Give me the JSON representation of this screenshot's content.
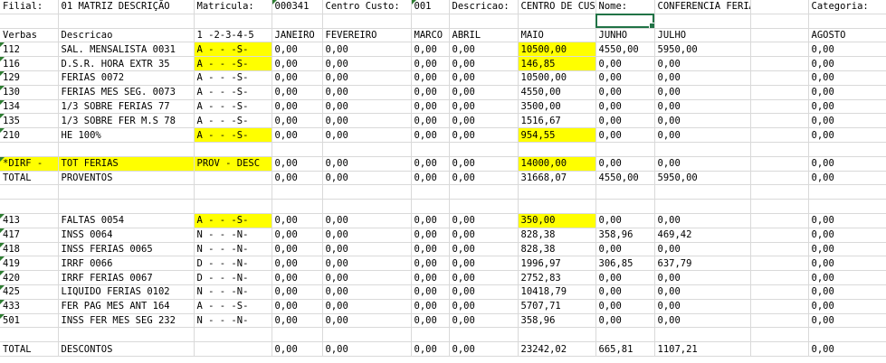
{
  "columns": 12,
  "highlight_color": "#ffff00",
  "rows": [
    {
      "cells": [
        {
          "t": "Filial:"
        },
        {
          "t": "01 MATRIZ DESCRIÇÃO"
        },
        {
          "t": "Matricula:"
        },
        {
          "t": "000341",
          "flag": true
        },
        {
          "t": "Centro Custo:"
        },
        {
          "t": "001",
          "flag": true
        },
        {
          "t": "Descricao:"
        },
        {
          "t": "CENTRO DE CUSTO"
        },
        {
          "t": "Nome:"
        },
        {
          "t": "CONFERENCIA FERIAS DIRF"
        },
        {
          "t": ""
        },
        {
          "t": "Categoria:"
        }
      ]
    },
    {
      "cells": [
        {
          "t": ""
        },
        {
          "t": ""
        },
        {
          "t": ""
        },
        {
          "t": ""
        },
        {
          "t": ""
        },
        {
          "t": ""
        },
        {
          "t": ""
        },
        {
          "t": ""
        },
        {
          "t": "",
          "sel": true
        },
        {
          "t": ""
        },
        {
          "t": ""
        },
        {
          "t": ""
        }
      ]
    },
    {
      "cells": [
        {
          "t": "Verbas"
        },
        {
          "t": "Descricao"
        },
        {
          "t": "1 -2-3-4-5"
        },
        {
          "t": "JANEIRO"
        },
        {
          "t": "FEVEREIRO"
        },
        {
          "t": "MARCO"
        },
        {
          "t": "ABRIL"
        },
        {
          "t": "MAIO"
        },
        {
          "t": "JUNHO"
        },
        {
          "t": "JULHO"
        },
        {
          "t": ""
        },
        {
          "t": "AGOSTO"
        }
      ]
    },
    {
      "cells": [
        {
          "t": "112",
          "flag": true
        },
        {
          "t": "SAL. MENSALISTA 0031"
        },
        {
          "t": "A - - -S-",
          "hl": true
        },
        {
          "t": "0,00"
        },
        {
          "t": "0,00"
        },
        {
          "t": "0,00"
        },
        {
          "t": "0,00"
        },
        {
          "t": "10500,00",
          "hl": true
        },
        {
          "t": "4550,00"
        },
        {
          "t": "5950,00"
        },
        {
          "t": ""
        },
        {
          "t": "0,00"
        }
      ]
    },
    {
      "cells": [
        {
          "t": "116",
          "flag": true
        },
        {
          "t": "D.S.R. HORA EXTR  35"
        },
        {
          "t": "A - - -S-",
          "hl": true
        },
        {
          "t": "0,00"
        },
        {
          "t": "0,00"
        },
        {
          "t": "0,00"
        },
        {
          "t": "0,00"
        },
        {
          "t": "146,85",
          "hl": true
        },
        {
          "t": "0,00"
        },
        {
          "t": "0,00"
        },
        {
          "t": ""
        },
        {
          "t": "0,00"
        }
      ]
    },
    {
      "cells": [
        {
          "t": "129",
          "flag": true
        },
        {
          "t": "FERIAS 0072"
        },
        {
          "t": "A - - -S-"
        },
        {
          "t": "0,00"
        },
        {
          "t": "0,00"
        },
        {
          "t": "0,00"
        },
        {
          "t": "0,00"
        },
        {
          "t": "10500,00"
        },
        {
          "t": "0,00"
        },
        {
          "t": "0,00"
        },
        {
          "t": ""
        },
        {
          "t": "0,00"
        }
      ]
    },
    {
      "cells": [
        {
          "t": "130",
          "flag": true
        },
        {
          "t": "FERIAS MES SEG. 0073"
        },
        {
          "t": "A - - -S-"
        },
        {
          "t": "0,00"
        },
        {
          "t": "0,00"
        },
        {
          "t": "0,00"
        },
        {
          "t": "0,00"
        },
        {
          "t": "4550,00"
        },
        {
          "t": "0,00"
        },
        {
          "t": "0,00"
        },
        {
          "t": ""
        },
        {
          "t": "0,00"
        }
      ]
    },
    {
      "cells": [
        {
          "t": "134",
          "flag": true
        },
        {
          "t": "1/3 SOBRE FERIAS 77"
        },
        {
          "t": "A - - -S-"
        },
        {
          "t": "0,00"
        },
        {
          "t": "0,00"
        },
        {
          "t": "0,00"
        },
        {
          "t": "0,00"
        },
        {
          "t": "3500,00"
        },
        {
          "t": "0,00"
        },
        {
          "t": "0,00"
        },
        {
          "t": ""
        },
        {
          "t": "0,00"
        }
      ]
    },
    {
      "cells": [
        {
          "t": "135",
          "flag": true
        },
        {
          "t": "1/3 SOBRE FER M.S 78"
        },
        {
          "t": "A - - -S-"
        },
        {
          "t": "0,00"
        },
        {
          "t": "0,00"
        },
        {
          "t": "0,00"
        },
        {
          "t": "0,00"
        },
        {
          "t": "1516,67"
        },
        {
          "t": "0,00"
        },
        {
          "t": "0,00"
        },
        {
          "t": ""
        },
        {
          "t": "0,00"
        }
      ]
    },
    {
      "cells": [
        {
          "t": "210",
          "flag": true
        },
        {
          "t": "HE 100%"
        },
        {
          "t": "A - - -S-",
          "hl": true
        },
        {
          "t": "0,00"
        },
        {
          "t": "0,00"
        },
        {
          "t": "0,00"
        },
        {
          "t": "0,00"
        },
        {
          "t": "954,55",
          "hl": true
        },
        {
          "t": "0,00"
        },
        {
          "t": "0,00"
        },
        {
          "t": ""
        },
        {
          "t": "0,00"
        }
      ]
    },
    {
      "cells": [
        {
          "t": ""
        },
        {
          "t": ""
        },
        {
          "t": ""
        },
        {
          "t": ""
        },
        {
          "t": ""
        },
        {
          "t": ""
        },
        {
          "t": ""
        },
        {
          "t": ""
        },
        {
          "t": ""
        },
        {
          "t": ""
        },
        {
          "t": ""
        },
        {
          "t": ""
        }
      ]
    },
    {
      "cells": [
        {
          "t": "*DIRF -",
          "hl": true,
          "flag": true
        },
        {
          "t": "  TOT FERIAS",
          "hl": true
        },
        {
          "t": "PROV - DESC",
          "hl": true
        },
        {
          "t": "0,00"
        },
        {
          "t": "0,00"
        },
        {
          "t": "0,00"
        },
        {
          "t": "0,00"
        },
        {
          "t": "14000,00",
          "hl": true
        },
        {
          "t": "0,00"
        },
        {
          "t": "0,00"
        },
        {
          "t": ""
        },
        {
          "t": "0,00"
        }
      ]
    },
    {
      "cells": [
        {
          "t": "TOTAL"
        },
        {
          "t": "PROVENTOS"
        },
        {
          "t": ""
        },
        {
          "t": "0,00"
        },
        {
          "t": "0,00"
        },
        {
          "t": "0,00"
        },
        {
          "t": "0,00"
        },
        {
          "t": "31668,07"
        },
        {
          "t": "4550,00"
        },
        {
          "t": "5950,00"
        },
        {
          "t": ""
        },
        {
          "t": "0,00"
        }
      ]
    },
    {
      "cells": [
        {
          "t": ""
        },
        {
          "t": ""
        },
        {
          "t": ""
        },
        {
          "t": ""
        },
        {
          "t": ""
        },
        {
          "t": ""
        },
        {
          "t": ""
        },
        {
          "t": ""
        },
        {
          "t": ""
        },
        {
          "t": ""
        },
        {
          "t": ""
        },
        {
          "t": ""
        }
      ]
    },
    {
      "cells": [
        {
          "t": ""
        },
        {
          "t": ""
        },
        {
          "t": ""
        },
        {
          "t": ""
        },
        {
          "t": ""
        },
        {
          "t": ""
        },
        {
          "t": ""
        },
        {
          "t": ""
        },
        {
          "t": ""
        },
        {
          "t": ""
        },
        {
          "t": ""
        },
        {
          "t": ""
        }
      ]
    },
    {
      "cells": [
        {
          "t": "413",
          "flag": true
        },
        {
          "t": "FALTAS 0054"
        },
        {
          "t": "A - - -S-",
          "hl": true
        },
        {
          "t": "0,00"
        },
        {
          "t": "0,00"
        },
        {
          "t": "0,00"
        },
        {
          "t": "0,00"
        },
        {
          "t": "350,00",
          "hl": true
        },
        {
          "t": "0,00"
        },
        {
          "t": "0,00"
        },
        {
          "t": ""
        },
        {
          "t": "0,00"
        }
      ]
    },
    {
      "cells": [
        {
          "t": "417",
          "flag": true
        },
        {
          "t": "INSS 0064"
        },
        {
          "t": "N - - -N-"
        },
        {
          "t": "0,00"
        },
        {
          "t": "0,00"
        },
        {
          "t": "0,00"
        },
        {
          "t": "0,00"
        },
        {
          "t": "828,38"
        },
        {
          "t": "358,96"
        },
        {
          "t": "469,42"
        },
        {
          "t": ""
        },
        {
          "t": "0,00"
        }
      ]
    },
    {
      "cells": [
        {
          "t": "418",
          "flag": true
        },
        {
          "t": "INSS FERIAS 0065"
        },
        {
          "t": "N - - -N-"
        },
        {
          "t": "0,00"
        },
        {
          "t": "0,00"
        },
        {
          "t": "0,00"
        },
        {
          "t": "0,00"
        },
        {
          "t": "828,38"
        },
        {
          "t": "0,00"
        },
        {
          "t": "0,00"
        },
        {
          "t": ""
        },
        {
          "t": "0,00"
        }
      ]
    },
    {
      "cells": [
        {
          "t": "419",
          "flag": true
        },
        {
          "t": "IRRF 0066"
        },
        {
          "t": "D - - -N-"
        },
        {
          "t": "0,00"
        },
        {
          "t": "0,00"
        },
        {
          "t": "0,00"
        },
        {
          "t": "0,00"
        },
        {
          "t": "1996,97"
        },
        {
          "t": "306,85"
        },
        {
          "t": "637,79"
        },
        {
          "t": ""
        },
        {
          "t": "0,00"
        }
      ]
    },
    {
      "cells": [
        {
          "t": "420",
          "flag": true
        },
        {
          "t": "IRRF FERIAS 0067"
        },
        {
          "t": "D - - -N-"
        },
        {
          "t": "0,00"
        },
        {
          "t": "0,00"
        },
        {
          "t": "0,00"
        },
        {
          "t": "0,00"
        },
        {
          "t": "2752,83"
        },
        {
          "t": "0,00"
        },
        {
          "t": "0,00"
        },
        {
          "t": ""
        },
        {
          "t": "0,00"
        }
      ]
    },
    {
      "cells": [
        {
          "t": "425",
          "flag": true
        },
        {
          "t": "LIQUIDO FERIAS 0102"
        },
        {
          "t": "N - - -N-"
        },
        {
          "t": "0,00"
        },
        {
          "t": "0,00"
        },
        {
          "t": "0,00"
        },
        {
          "t": "0,00"
        },
        {
          "t": "10418,79"
        },
        {
          "t": "0,00"
        },
        {
          "t": "0,00"
        },
        {
          "t": ""
        },
        {
          "t": "0,00"
        }
      ]
    },
    {
      "cells": [
        {
          "t": "433",
          "flag": true
        },
        {
          "t": "FER PAG MES ANT 164"
        },
        {
          "t": "A - - -S-"
        },
        {
          "t": "0,00"
        },
        {
          "t": "0,00"
        },
        {
          "t": "0,00"
        },
        {
          "t": "0,00"
        },
        {
          "t": "5707,71"
        },
        {
          "t": "0,00"
        },
        {
          "t": "0,00"
        },
        {
          "t": ""
        },
        {
          "t": "0,00"
        }
      ]
    },
    {
      "cells": [
        {
          "t": "501",
          "flag": true
        },
        {
          "t": "INSS FER MES SEG 232"
        },
        {
          "t": "N - - -N-"
        },
        {
          "t": "0,00"
        },
        {
          "t": "0,00"
        },
        {
          "t": "0,00"
        },
        {
          "t": "0,00"
        },
        {
          "t": "358,96"
        },
        {
          "t": "0,00"
        },
        {
          "t": "0,00"
        },
        {
          "t": ""
        },
        {
          "t": "0,00"
        }
      ]
    },
    {
      "cells": [
        {
          "t": ""
        },
        {
          "t": ""
        },
        {
          "t": ""
        },
        {
          "t": ""
        },
        {
          "t": ""
        },
        {
          "t": ""
        },
        {
          "t": ""
        },
        {
          "t": ""
        },
        {
          "t": ""
        },
        {
          "t": ""
        },
        {
          "t": ""
        },
        {
          "t": ""
        }
      ]
    },
    {
      "cells": [
        {
          "t": "TOTAL"
        },
        {
          "t": "DESCONTOS"
        },
        {
          "t": ""
        },
        {
          "t": "0,00"
        },
        {
          "t": "0,00"
        },
        {
          "t": "0,00"
        },
        {
          "t": "0,00"
        },
        {
          "t": "23242,02"
        },
        {
          "t": "665,81"
        },
        {
          "t": "1107,21"
        },
        {
          "t": ""
        },
        {
          "t": "0,00"
        }
      ]
    }
  ]
}
